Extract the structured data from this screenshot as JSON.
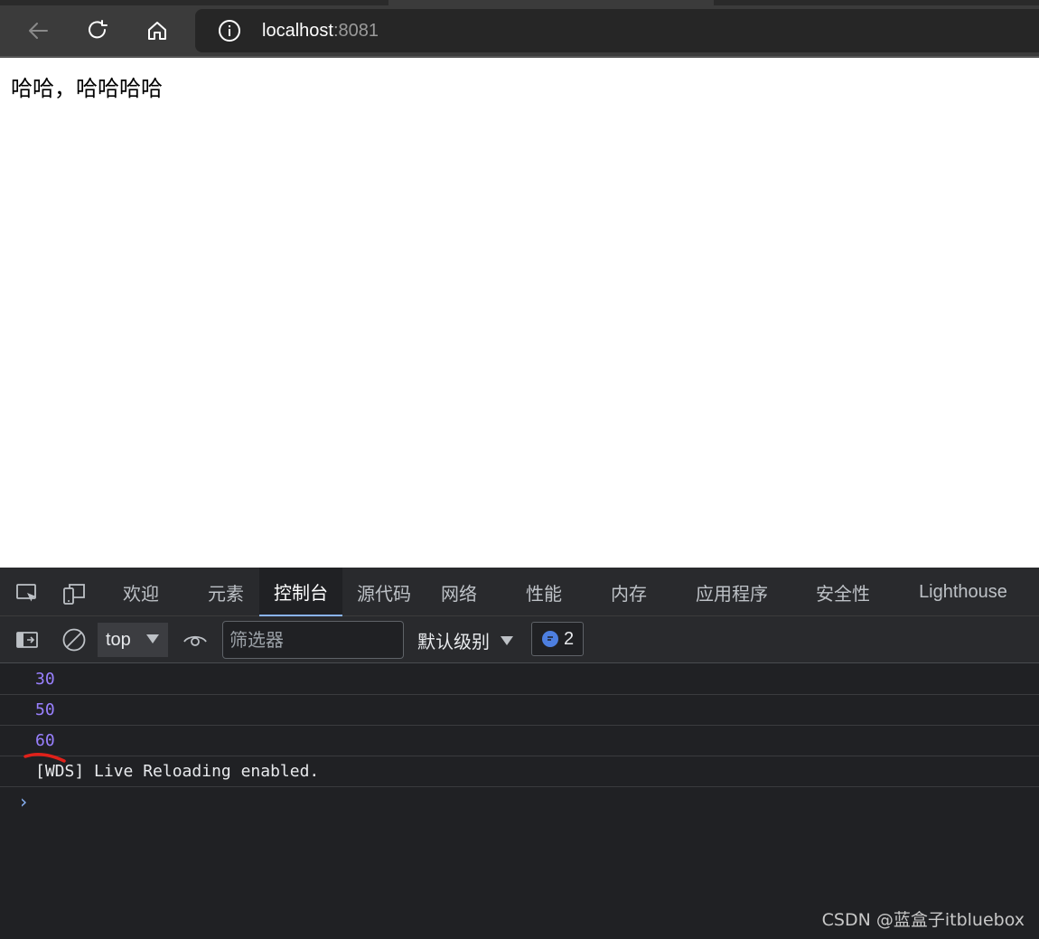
{
  "browser": {
    "url_host": "localhost",
    "url_port": ":8081",
    "icons": {
      "back": "arrow-left-icon",
      "reload": "reload-icon",
      "home": "home-icon",
      "info": "info-icon"
    }
  },
  "page": {
    "text": "哈哈，哈哈哈哈"
  },
  "devtools": {
    "tabs": [
      {
        "label": "欢迎"
      },
      {
        "label": "元素"
      },
      {
        "label": "控制台"
      },
      {
        "label": "源代码"
      },
      {
        "label": "网络"
      },
      {
        "label": "性能"
      },
      {
        "label": "内存"
      },
      {
        "label": "应用程序"
      },
      {
        "label": "安全性"
      },
      {
        "label": "Lighthouse"
      }
    ],
    "active_tab": "控制台",
    "toolbar": {
      "context": "top",
      "filter_placeholder": "筛选器",
      "levels": "默认级别",
      "issues_count": "2"
    },
    "console_rows": [
      {
        "text": "30",
        "kind": "number"
      },
      {
        "text": "50",
        "kind": "number"
      },
      {
        "text": "60",
        "kind": "number"
      },
      {
        "text": "[WDS] Live Reloading enabled.",
        "kind": "log"
      }
    ],
    "prompt": "›"
  },
  "colors": {
    "number": "#9980ff",
    "accent": "#8ab4f8",
    "annotation": "#e0211a"
  },
  "watermark": "CSDN @蓝盒子itbluebox"
}
